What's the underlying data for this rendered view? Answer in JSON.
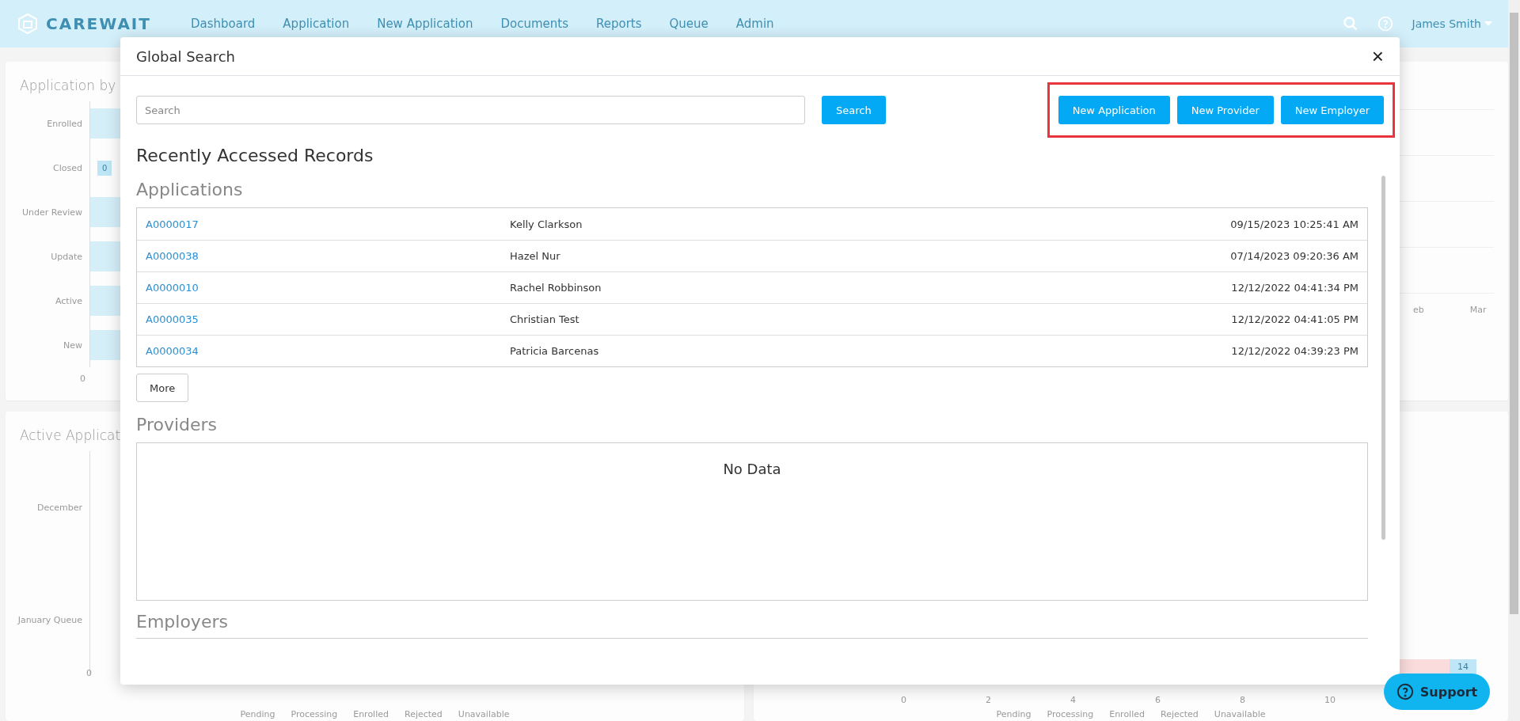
{
  "nav": {
    "brand": "CAREWAIT",
    "items": [
      "Dashboard",
      "Application",
      "New Application",
      "Documents",
      "Reports",
      "Queue",
      "Admin"
    ],
    "user": "James Smith"
  },
  "background": {
    "status_card": {
      "title": "Application by",
      "labels": [
        "Enrolled",
        "Closed",
        "Under Review",
        "Update",
        "Active",
        "New"
      ],
      "bar_value": "0",
      "axis_tick": "0"
    },
    "trend_card": {
      "ticks": [
        "eb",
        "Mar"
      ]
    },
    "active_card": {
      "title": "Active Applicat",
      "labels": [
        "December",
        "January Queue"
      ],
      "axis_tick": "0",
      "legend": [
        "Pending",
        "Processing",
        "Enrolled",
        "Rejected",
        "Unavailable"
      ]
    },
    "count_card": {
      "badge": "14",
      "ticks": [
        "0",
        "2",
        "4",
        "6",
        "8",
        "10"
      ],
      "legend": [
        "Pending",
        "Processing",
        "Enrolled",
        "Rejected",
        "Unavailable"
      ]
    }
  },
  "modal": {
    "title": "Global Search",
    "close": "×",
    "search": {
      "placeholder": "Search",
      "button": "Search"
    },
    "actions": [
      "New Application",
      "New Provider",
      "New Employer"
    ],
    "heading": "Recently Accessed Records",
    "applications": {
      "title": "Applications",
      "rows": [
        {
          "id": "A0000017",
          "name": "Kelly Clarkson",
          "accessed": "09/15/2023 10:25:41 AM"
        },
        {
          "id": "A0000038",
          "name": "Hazel Nur",
          "accessed": "07/14/2023 09:20:36 AM"
        },
        {
          "id": "A0000010",
          "name": "Rachel Robbinson",
          "accessed": "12/12/2022 04:41:34 PM"
        },
        {
          "id": "A0000035",
          "name": "Christian Test",
          "accessed": "12/12/2022 04:41:05 PM"
        },
        {
          "id": "A0000034",
          "name": "Patricia Barcenas",
          "accessed": "12/12/2022 04:39:23 PM"
        }
      ],
      "more": "More"
    },
    "providers": {
      "title": "Providers",
      "empty": "No Data"
    },
    "employers": {
      "title": "Employers"
    }
  },
  "support": "Support"
}
